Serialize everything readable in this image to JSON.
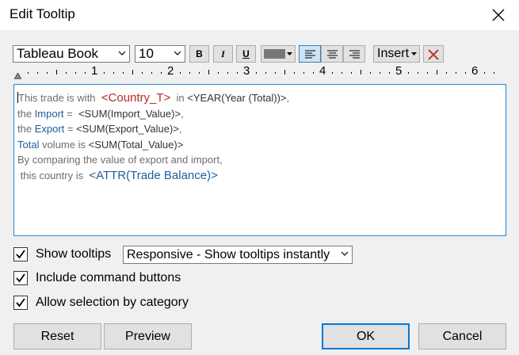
{
  "dialog": {
    "title": "Edit Tooltip"
  },
  "toolbar": {
    "font_family": "Tableau Book",
    "font_size": "10",
    "bold_label": "B",
    "italic_label": "I",
    "underline_label": "U",
    "text_color": "#777777",
    "insert_label": "Insert",
    "active_alignment": "left"
  },
  "ruler": {
    "labels": [
      "1",
      "2",
      "3",
      "4",
      "5",
      "6"
    ]
  },
  "editor": {
    "lines": [
      [
        {
          "text": "This trade is with  ",
          "style": "gray"
        },
        {
          "text": "<Country_T>",
          "style": "red"
        },
        {
          "text": "  in ",
          "style": "gray"
        },
        {
          "text": "<YEAR(Year (Total))>",
          "style": "dark"
        },
        {
          "text": ",",
          "style": "gray"
        }
      ],
      [
        {
          "text": "the ",
          "style": "gray"
        },
        {
          "text": "Import",
          "style": "blue"
        },
        {
          "text": " =  ",
          "style": "gray"
        },
        {
          "text": "<SUM(Import_Value)>",
          "style": "dark"
        },
        {
          "text": ",",
          "style": "gray"
        }
      ],
      [
        {
          "text": "the ",
          "style": "gray"
        },
        {
          "text": "Export",
          "style": "blue"
        },
        {
          "text": " = ",
          "style": "gray"
        },
        {
          "text": "<SUM(Export_Value)>",
          "style": "dark"
        },
        {
          "text": ",",
          "style": "gray"
        }
      ],
      [
        {
          "text": "Total",
          "style": "blue"
        },
        {
          "text": " volume is ",
          "style": "gray"
        },
        {
          "text": "<SUM(Total_Value)>",
          "style": "dark"
        }
      ],
      [
        {
          "text": "By comparing the value of export and import,",
          "style": "gray"
        }
      ],
      [
        {
          "text": " this country is  ",
          "style": "gray"
        },
        {
          "text": "<ATTR(Trade Balance)>",
          "style": "large-blue"
        }
      ]
    ]
  },
  "options": {
    "show_tooltips": {
      "label": "Show tooltips",
      "checked": true
    },
    "tooltip_mode": "Responsive - Show tooltips instantly",
    "include_command_buttons": {
      "label": "Include command buttons",
      "checked": true
    },
    "allow_selection": {
      "label": "Allow selection by category",
      "checked": true
    }
  },
  "buttons": {
    "reset": "Reset",
    "preview": "Preview",
    "ok": "OK",
    "cancel": "Cancel"
  },
  "colors": {
    "accent": "#0078d7",
    "field_blue": "#1f5d9a",
    "field_red": "#b52a24"
  }
}
